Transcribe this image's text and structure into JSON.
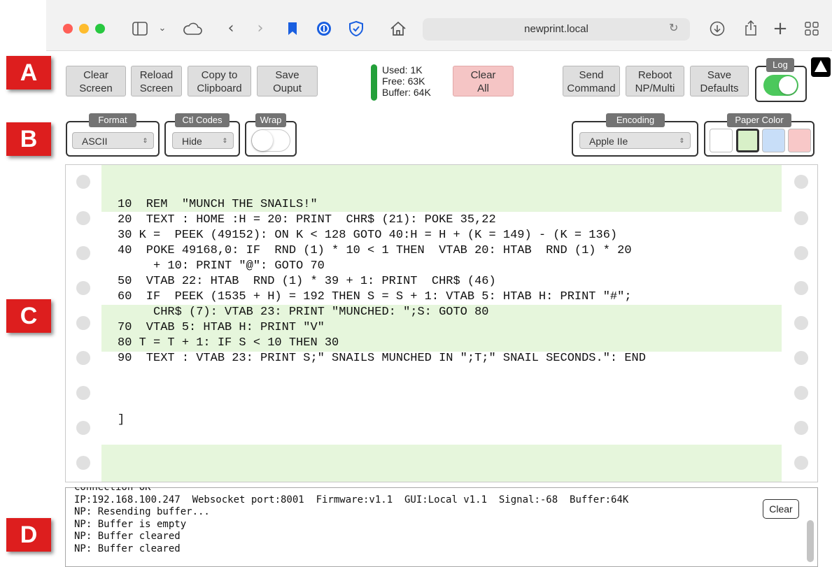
{
  "browser": {
    "url": "newprint.local",
    "traffic_light_colors": [
      "#ff5f57",
      "#febc2e",
      "#28c840"
    ],
    "icons": [
      "sidebar-icon",
      "chevron-down-icon",
      "cloud-icon",
      "back-icon",
      "forward-icon",
      "bookmark-icon",
      "password-manager-icon",
      "shield-icon",
      "home-icon",
      "reload-icon",
      "download-icon",
      "share-icon",
      "new-tab-icon",
      "tab-overview-icon"
    ]
  },
  "badges": {
    "a": "A",
    "b": "B",
    "c": "C",
    "d": "D",
    "color": "#dd1e1e"
  },
  "toolbar": {
    "clear_screen": "Clear\nScreen",
    "reload_screen": "Reload\nScreen",
    "copy_clipboard": "Copy to\nClipboard",
    "save_output": "Save\nOuput",
    "memory": {
      "used": "Used: 1K",
      "free": "Free: 63K",
      "buffer": "Buffer: 64K",
      "level_fraction": 0.016
    },
    "clear_all": "Clear\nAll",
    "send_command": "Send\nCommand",
    "reboot": "Reboot\nNP/Multi",
    "save_defaults": "Save\nDefaults",
    "log_label": "Log",
    "log_enabled": true
  },
  "options": {
    "format_label": "Format",
    "format_value": "ASCII",
    "ctl_label": "Ctl Codes",
    "ctl_value": "Hide",
    "wrap_label": "Wrap",
    "wrap_enabled": false,
    "encoding_label": "Encoding",
    "encoding_value": "Apple IIe",
    "paper_label": "Paper Color",
    "paper_colors": [
      "#ffffff",
      "#d8f0c8",
      "#c8def8",
      "#f8c8c8"
    ],
    "paper_selected": 1
  },
  "paper": {
    "band_color": "#e6f6dc",
    "text": "10  REM  \"MUNCH THE SNAILS!\"\n20  TEXT : HOME :H = 20: PRINT  CHR$ (21): POKE 35,22\n30 K =  PEEK (49152): ON K < 128 GOTO 40:H = H + (K = 149) - (K = 136)\n40  POKE 49168,0: IF  RND (1) * 10 < 1 THEN  VTAB 20: HTAB  RND (1) * 20\n     + 10: PRINT \"@\": GOTO 70\n50  VTAB 22: HTAB  RND (1) * 39 + 1: PRINT  CHR$ (46)\n60  IF  PEEK (1535 + H) = 192 THEN S = S + 1: VTAB 5: HTAB H: PRINT \"#\";\n     CHR$ (7): VTAB 23: PRINT \"MUNCHED: \";S: GOTO 80\n70  VTAB 5: HTAB H: PRINT \"V\"\n80 T = T + 1: IF S < 10 THEN 30\n90  TEXT : VTAB 23: PRINT S;\" SNAILS MUNCHED IN \";T;\" SNAIL SECONDS.\": END\n\n\n\n]"
  },
  "console": {
    "lines": "Connection OK\nIP:192.168.100.247  Websocket port:8001  Firmware:v1.1  GUI:Local v1.1  Signal:-68  Buffer:64K\nNP: Resending buffer...\nNP: Buffer is empty\nNP: Buffer cleared\nNP: Buffer cleared",
    "clear_label": "Clear"
  }
}
